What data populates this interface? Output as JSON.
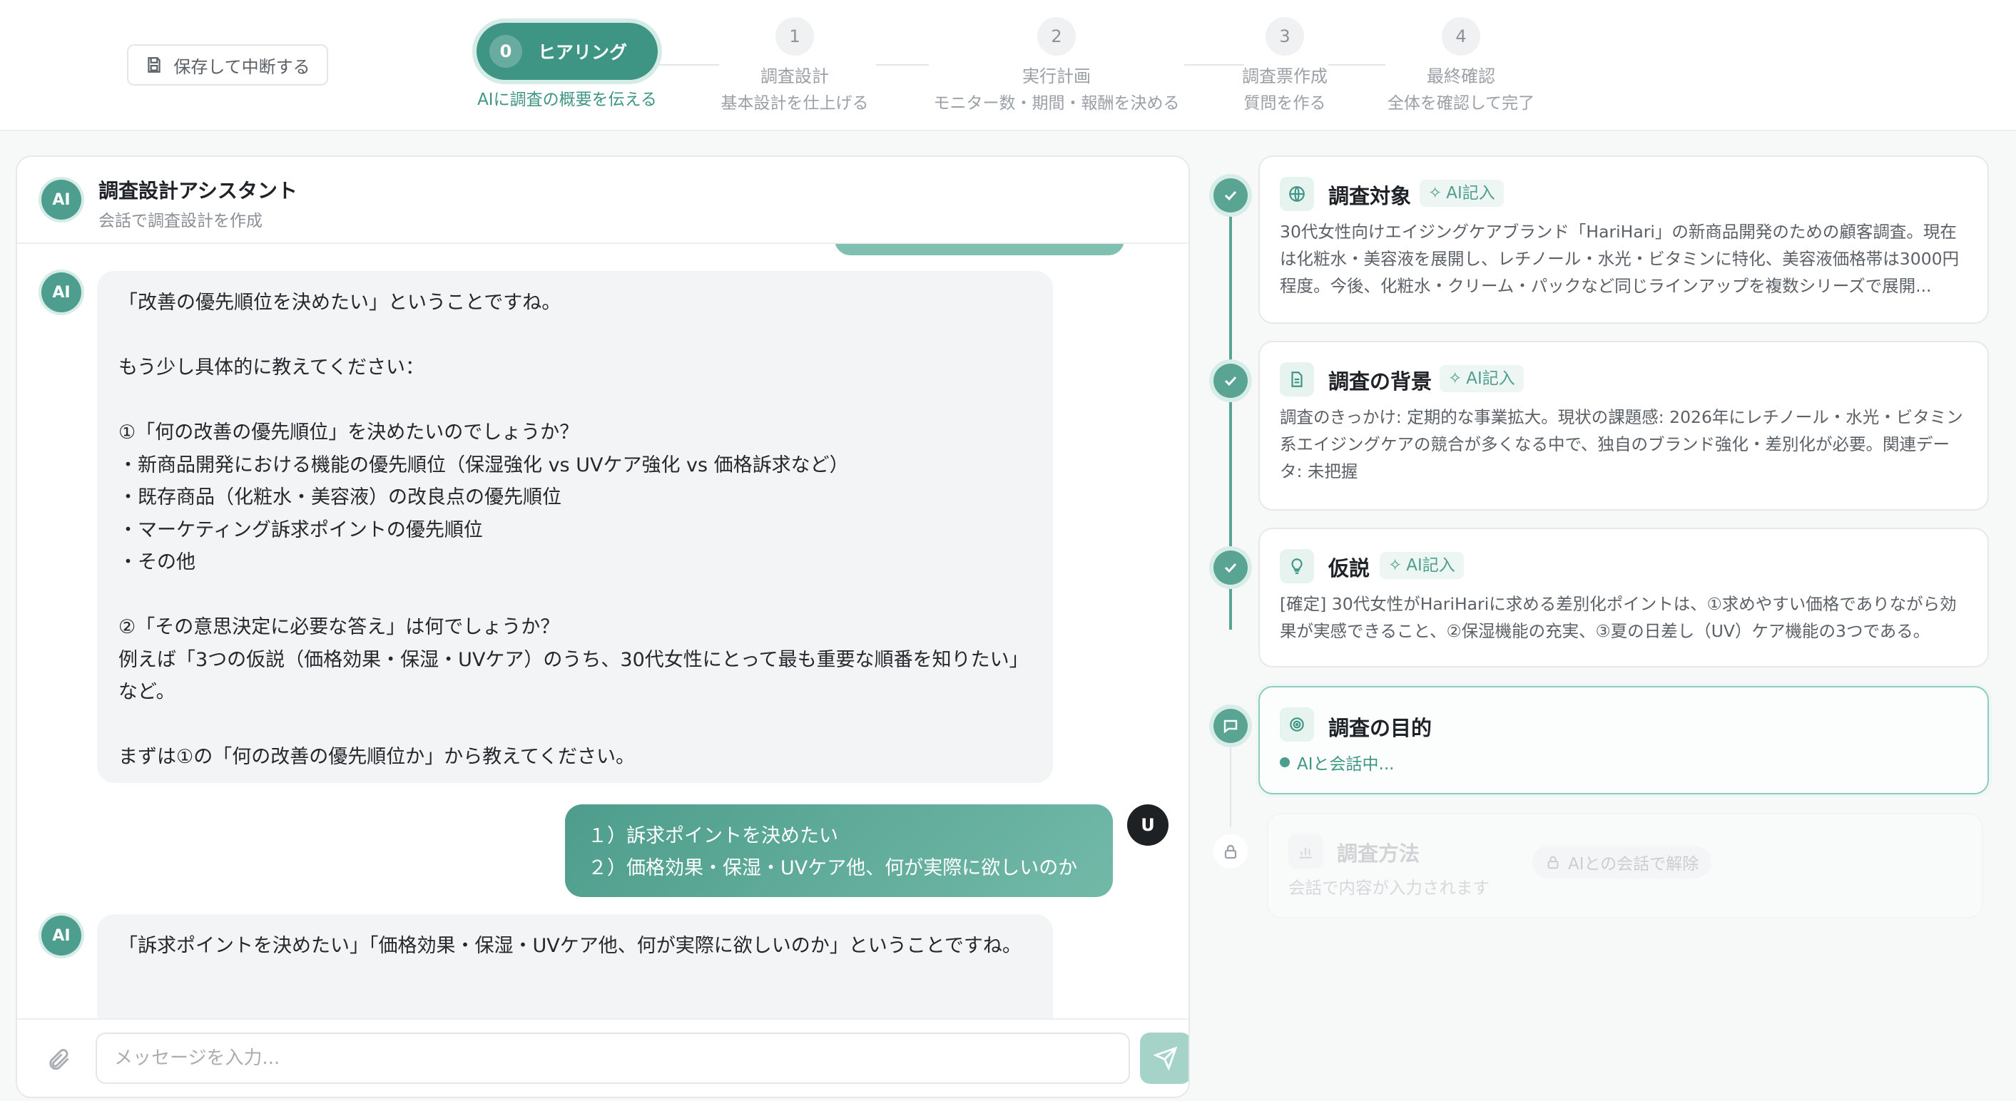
{
  "header": {
    "save_label": "保存して中断する",
    "steps": [
      {
        "num": "0",
        "label": "ヒアリング",
        "sub": "AIに調査の概要を伝える"
      },
      {
        "num": "1",
        "label": "調査設計",
        "sub": "基本設計を仕上げる"
      },
      {
        "num": "2",
        "label": "実行計画",
        "sub": "モニター数・期間・報酬を決める"
      },
      {
        "num": "3",
        "label": "調査票作成",
        "sub": "質問を作る"
      },
      {
        "num": "4",
        "label": "最終確認",
        "sub": "全体を確認して完了"
      }
    ]
  },
  "chat": {
    "avatar": "AI",
    "title": "調査設計アシスタント",
    "subtitle": "会話で調査設計を作成",
    "messages": [
      {
        "role": "ai",
        "avatar": "AI",
        "text": "「改善の優先順位を決めたい」ということですね。\n\nもう少し具体的に教えてください：\n\n①「何の改善の優先順位」を決めたいのでしょうか？\n・新商品開発における機能の優先順位（保湿強化 vs UVケア強化 vs 価格訴求など）\n・既存商品（化粧水・美容液）の改良点の優先順位\n・マーケティング訴求ポイントの優先順位\n・その他\n\n②「その意思決定に必要な答え」は何でしょうか？\n例えば「3つの仮説（価格効果・保湿・UVケア）のうち、30代女性にとって最も重要な順番を知りたい」など。\n\nまずは①の「何の改善の優先順位か」から教えてください。"
      },
      {
        "role": "user",
        "avatar": "U",
        "text": "１）訴求ポイントを決めたい\n２）価格効果・保湿・UVケア他、何が実際に欲しいのか"
      },
      {
        "role": "ai",
        "avatar": "AI",
        "text": "「訴求ポイントを決めたい」「価格効果・保湿・UVケア他、何が実際に欲しいのか」ということですね。"
      }
    ],
    "input_placeholder": "メッセージを入力..."
  },
  "sections": [
    {
      "title": "調査対象",
      "badge": "AI記入",
      "state": "done",
      "icon": "globe-icon",
      "text": "30代女性向けエイジングケアブランド「HariHari」の新商品開発のための顧客調査。現在は化粧水・美容液を展開し、レチノール・水光・ビタミンに特化、美容液価格帯は3000円程度。今後、化粧水・クリーム・パックなど同じラインアップを複数シリーズで展開..."
    },
    {
      "title": "調査の背景",
      "badge": "AI記入",
      "state": "done",
      "icon": "document-icon",
      "text": "調査のきっかけ: 定期的な事業拡大。現状の課題感: 2026年にレチノール・水光・ビタミン系エイジングケアの競合が多くなる中で、独自のブランド強化・差別化が必要。関連データ: 未把握"
    },
    {
      "title": "仮説",
      "badge": "AI記入",
      "state": "done",
      "icon": "lightbulb-icon",
      "text": "[確定] 30代女性がHariHariに求める差別化ポイントは、①求めやすい価格でありながら効果が実感できること、②保湿機能の充実、③夏の日差し（UV）ケア機能の3つである。"
    },
    {
      "title": "調査の目的",
      "state": "active",
      "icon": "target-icon",
      "status": "AIと会話中..."
    },
    {
      "title": "調査方法",
      "state": "locked",
      "icon": "bar-chart-icon",
      "subtitle": "会話で内容が入力されます",
      "lock_label": "AIとの会話で解除"
    }
  ],
  "colors": {
    "accent": "#4d9e8e",
    "accent_light": "#d9ede8"
  }
}
